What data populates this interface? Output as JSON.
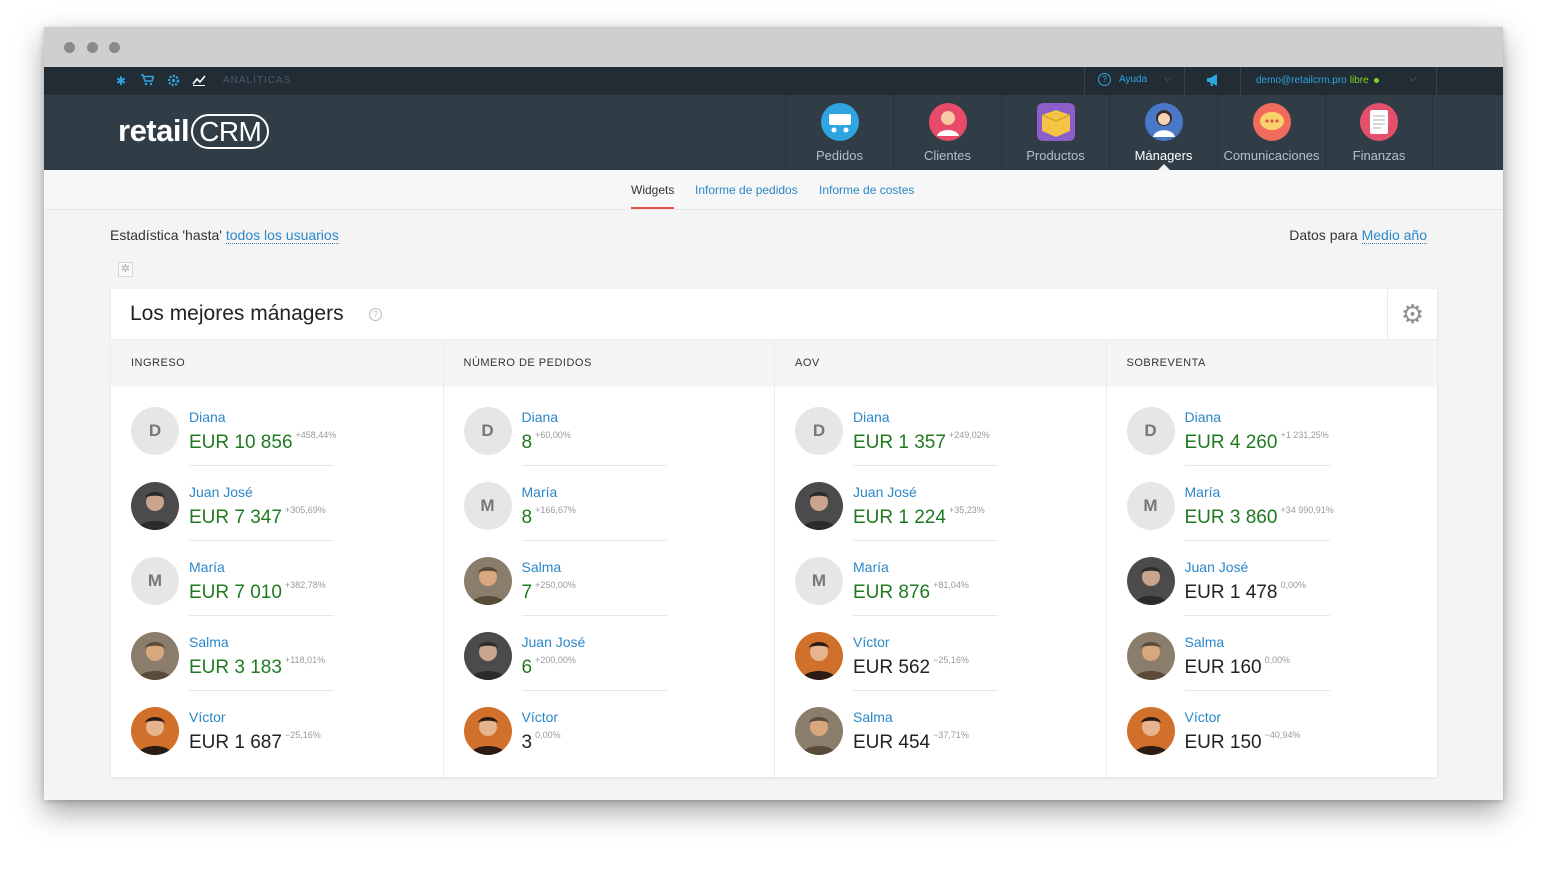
{
  "topbar": {
    "section_label": "ANALÍTICAS",
    "help_label": "Ayuda",
    "email": "demo@retailcrm.pro",
    "status": "libre"
  },
  "header": {
    "logo_left": "retail",
    "logo_right": "CRM",
    "modules": [
      {
        "label": "Pedidos",
        "color": "#2ea4e0"
      },
      {
        "label": "Clientes",
        "color": "#e84b6a"
      },
      {
        "label": "Productos",
        "color": "#f4c447"
      },
      {
        "label": "Mánagers",
        "color": "#4a78c8"
      },
      {
        "label": "Comunicaciones",
        "color": "#f06b5b"
      },
      {
        "label": "Finanzas",
        "color": "#e44f6c"
      }
    ]
  },
  "subnav": {
    "tabs": [
      "Widgets",
      "Informe de pedidos",
      "Informe de costes"
    ]
  },
  "filters": {
    "left_prefix": "Estadística 'hasta' ",
    "left_link": "todos los usuarios",
    "right_prefix": "Datos para ",
    "right_link": "Medio año"
  },
  "widget": {
    "title": "Los mejores mánagers",
    "columns": [
      {
        "header": "INGRESO",
        "rows": [
          {
            "name": "Diana",
            "initial": "D",
            "value": "EUR 10 856",
            "pct": "+458,44%",
            "positive": true
          },
          {
            "name": "Juan José",
            "initial": "",
            "value": "EUR 7 347",
            "pct": "+305,69%",
            "positive": true
          },
          {
            "name": "María",
            "initial": "M",
            "value": "EUR 7 010",
            "pct": "+382,78%",
            "positive": true
          },
          {
            "name": "Salma",
            "initial": "",
            "value": "EUR 3 183",
            "pct": "+118,01%",
            "positive": true
          },
          {
            "name": "Víctor",
            "initial": "",
            "value": "EUR 1 687",
            "pct": "−25,16%",
            "positive": false
          }
        ]
      },
      {
        "header": "NÚMERO DE PEDIDOS",
        "rows": [
          {
            "name": "Diana",
            "initial": "D",
            "value": "8",
            "pct": "+60,00%",
            "positive": true
          },
          {
            "name": "María",
            "initial": "M",
            "value": "8",
            "pct": "+166,67%",
            "positive": true
          },
          {
            "name": "Salma",
            "initial": "",
            "value": "7",
            "pct": "+250,00%",
            "positive": true
          },
          {
            "name": "Juan José",
            "initial": "",
            "value": "6",
            "pct": "+200,00%",
            "positive": true
          },
          {
            "name": "Víctor",
            "initial": "",
            "value": "3",
            "pct": "0,00%",
            "positive": false
          }
        ]
      },
      {
        "header": "AOV",
        "rows": [
          {
            "name": "Diana",
            "initial": "D",
            "value": "EUR 1 357",
            "pct": "+249,02%",
            "positive": true
          },
          {
            "name": "Juan José",
            "initial": "",
            "value": "EUR 1 224",
            "pct": "+35,23%",
            "positive": true
          },
          {
            "name": "María",
            "initial": "M",
            "value": "EUR 876",
            "pct": "+81,04%",
            "positive": true
          },
          {
            "name": "Víctor",
            "initial": "",
            "value": "EUR 562",
            "pct": "−25,16%",
            "positive": false
          },
          {
            "name": "Salma",
            "initial": "",
            "value": "EUR 454",
            "pct": "−37,71%",
            "positive": false
          }
        ]
      },
      {
        "header": "SOBREVENTA",
        "rows": [
          {
            "name": "Diana",
            "initial": "D",
            "value": "EUR 4 260",
            "pct": "+1 231,25%",
            "positive": true
          },
          {
            "name": "María",
            "initial": "M",
            "value": "EUR 3 860",
            "pct": "+34 990,91%",
            "positive": true
          },
          {
            "name": "Juan José",
            "initial": "",
            "value": "EUR 1 478",
            "pct": "0,00%",
            "positive": false
          },
          {
            "name": "Salma",
            "initial": "",
            "value": "EUR 160",
            "pct": "0,00%",
            "positive": false
          },
          {
            "name": "Víctor",
            "initial": "",
            "value": "EUR 150",
            "pct": "−40,94%",
            "positive": false
          }
        ]
      }
    ]
  }
}
